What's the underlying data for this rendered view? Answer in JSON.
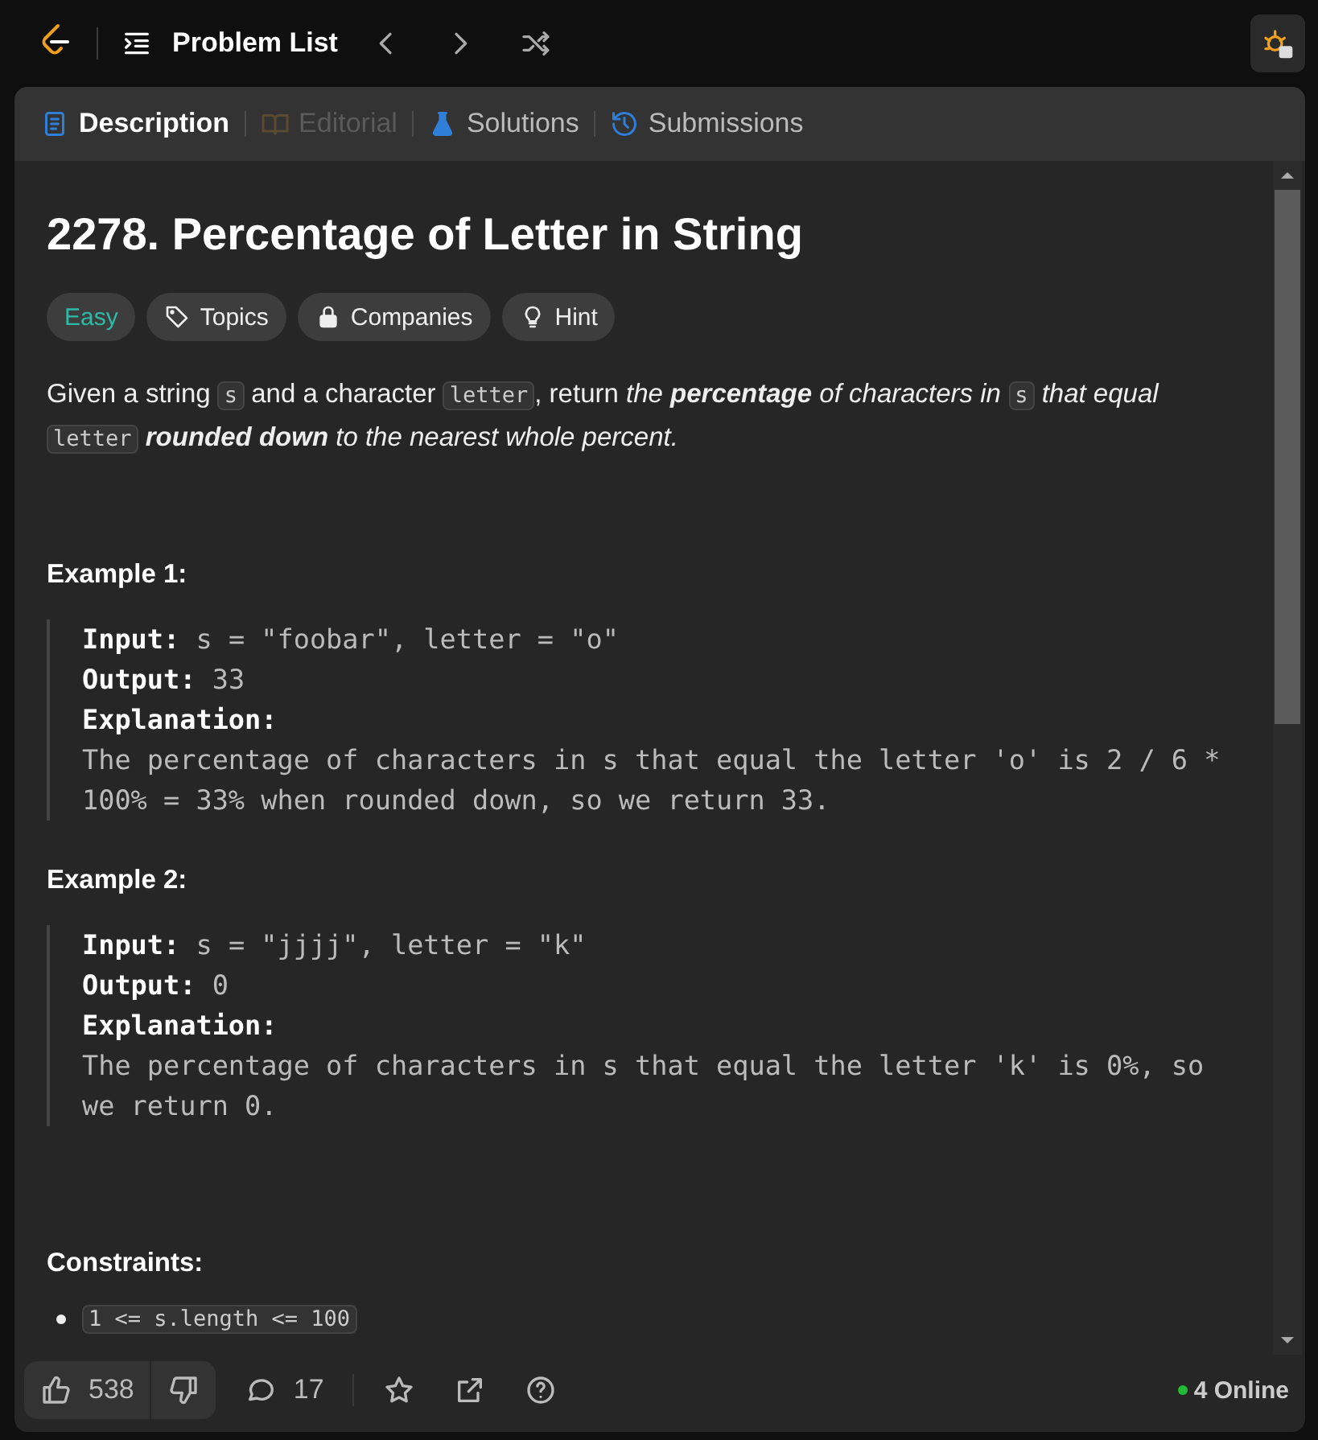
{
  "topbar": {
    "title": "Problem List"
  },
  "tabs": [
    {
      "label": "Description",
      "selected": true,
      "disabled": false
    },
    {
      "label": "Editorial",
      "selected": false,
      "disabled": true
    },
    {
      "label": "Solutions",
      "selected": false,
      "disabled": false
    },
    {
      "label": "Submissions",
      "selected": false,
      "disabled": false
    }
  ],
  "problem": {
    "title": "2278. Percentage of Letter in String",
    "tags": [
      {
        "kind": "difficulty",
        "label": "Easy"
      },
      {
        "kind": "tag",
        "label": "Topics"
      },
      {
        "kind": "lock",
        "label": "Companies"
      },
      {
        "kind": "bulb",
        "label": "Hint"
      }
    ],
    "description": [
      {
        "kind": "text",
        "text": "Given a string "
      },
      {
        "kind": "code",
        "text": "s"
      },
      {
        "kind": "text",
        "text": " and a character "
      },
      {
        "kind": "code",
        "text": "letter"
      },
      {
        "kind": "text",
        "text": ", return *the* **percentage** *of characters in* "
      },
      {
        "kind": "code",
        "text": "s"
      },
      {
        "kind": "text",
        "text": " *that equal* "
      },
      {
        "kind": "code",
        "text": "letter"
      },
      {
        "kind": "text",
        "text": " **rounded down** *to the nearest whole percent.*"
      }
    ],
    "examples": [
      {
        "title": "Example 1:",
        "lines": [
          {
            "label": "Input:",
            "value": "s = \"foobar\", letter = \"o\""
          },
          {
            "label": "Output:",
            "value": "33"
          }
        ],
        "explanation_label": "Explanation:",
        "explanation": "The percentage of characters in s that equal the letter 'o' is 2 / 6 * 100% = 33% when rounded down, so we return 33."
      },
      {
        "title": "Example 2:",
        "lines": [
          {
            "label": "Input:",
            "value": "s = \"jjjj\", letter = \"k\""
          },
          {
            "label": "Output:",
            "value": "0"
          }
        ],
        "explanation_label": "Explanation:",
        "explanation": "The percentage of characters in s that equal the letter 'k' is 0%, so we return 0."
      }
    ],
    "constraints_title": "Constraints:",
    "constraints": [
      "1 <= s.length <= 100"
    ]
  },
  "footer": {
    "likes": "538",
    "comments": "17",
    "online": "4 Online"
  }
}
